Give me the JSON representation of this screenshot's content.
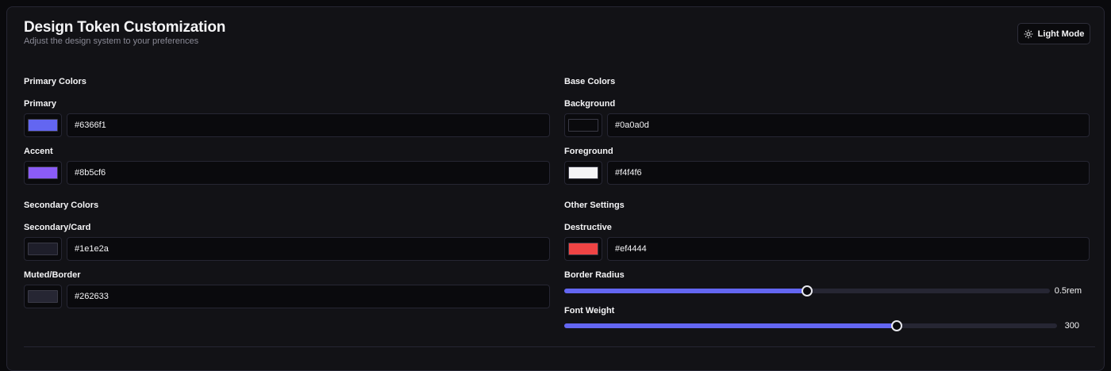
{
  "header": {
    "title": "Design Token Customization",
    "subtitle": "Adjust the design system to your preferences",
    "mode_button": {
      "label": "Light Mode",
      "icon": "sun-icon"
    }
  },
  "sections": {
    "primary": {
      "title": "Primary Colors",
      "fields": [
        {
          "label": "Primary",
          "value": "#6366f1",
          "color": "#6366f1"
        },
        {
          "label": "Accent",
          "value": "#8b5cf6",
          "color": "#8b5cf6"
        }
      ]
    },
    "secondary": {
      "title": "Secondary Colors",
      "fields": [
        {
          "label": "Secondary/Card",
          "value": "#1e1e2a",
          "color": "#1e1e2a"
        },
        {
          "label": "Muted/Border",
          "value": "#262633",
          "color": "#262633"
        }
      ]
    },
    "base": {
      "title": "Base Colors",
      "fields": [
        {
          "label": "Background",
          "value": "#0a0a0d",
          "color": "#0a0a0d"
        },
        {
          "label": "Foreground",
          "value": "#f4f4f6",
          "color": "#f4f4f6"
        }
      ]
    },
    "other": {
      "title": "Other Settings",
      "destructive": {
        "label": "Destructive",
        "value": "#ef4444",
        "color": "#ef4444"
      },
      "border_radius": {
        "label": "Border Radius",
        "value_text": "0.5rem",
        "fraction": 0.5
      },
      "font_weight": {
        "label": "Font Weight",
        "value_text": "300",
        "fraction": 0.675
      }
    }
  },
  "colors": {
    "accent": "#6366f1",
    "panel": "#121216",
    "border": "#262633"
  }
}
